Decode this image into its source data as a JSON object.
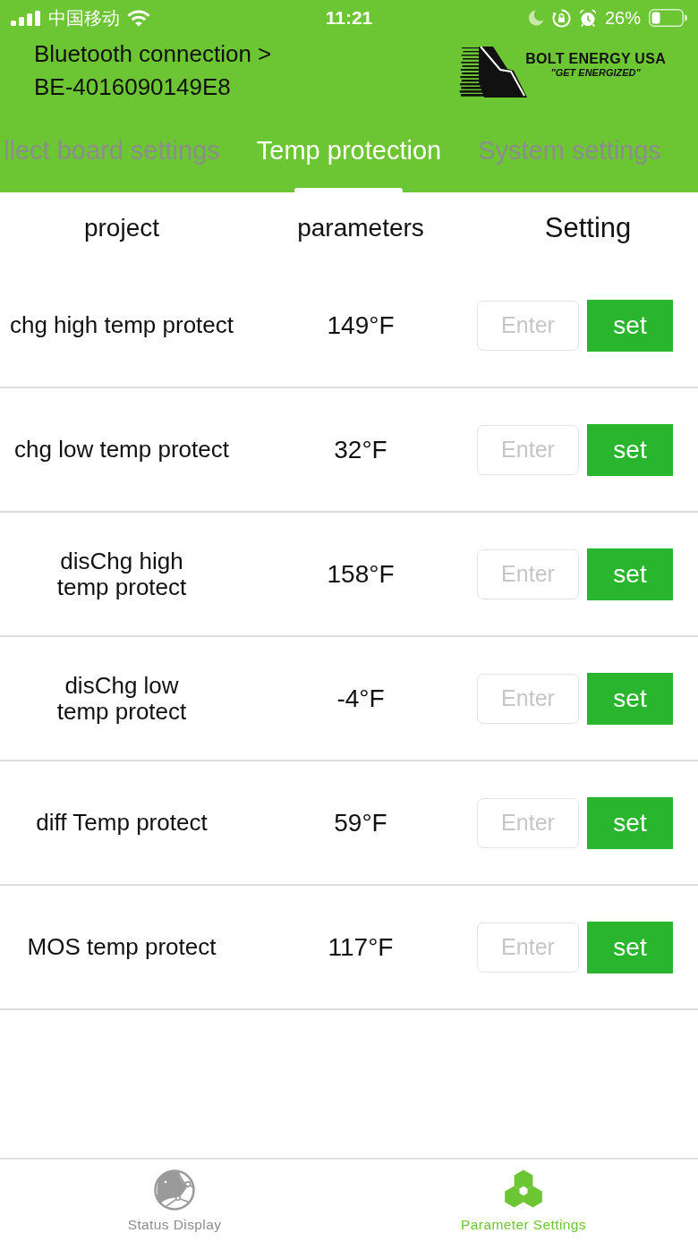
{
  "status_bar": {
    "carrier": "中国移动",
    "time": "11:21",
    "battery": "26%"
  },
  "header": {
    "connection_label": "Bluetooth connection >",
    "device_id": "BE-4016090149E8",
    "logo": {
      "title": "BOLT ENERGY USA",
      "tagline": "\"GET ENERGIZED\""
    }
  },
  "tabs": [
    {
      "label": "llect board settings",
      "selected": false
    },
    {
      "label": "Temp protection",
      "selected": true
    },
    {
      "label": "System settings",
      "selected": false
    }
  ],
  "table": {
    "columns": [
      "project",
      "parameters",
      "Setting"
    ],
    "rows": [
      {
        "project": "chg high temp protect",
        "parameter": "149°F",
        "placeholder": "Enter",
        "button": "set"
      },
      {
        "project": "chg low temp protect",
        "parameter": "32°F",
        "placeholder": "Enter",
        "button": "set"
      },
      {
        "project": "disChg high\ntemp protect",
        "parameter": "158°F",
        "placeholder": "Enter",
        "button": "set"
      },
      {
        "project": "disChg low\ntemp protect",
        "parameter": "-4°F",
        "placeholder": "Enter",
        "button": "set"
      },
      {
        "project": "diff Temp protect",
        "parameter": "59°F",
        "placeholder": "Enter",
        "button": "set"
      },
      {
        "project": "MOS temp protect",
        "parameter": "117°F",
        "placeholder": "Enter",
        "button": "set"
      }
    ]
  },
  "bottom_nav": [
    {
      "kind": "status",
      "label": "Status Display",
      "selected": false
    },
    {
      "kind": "parameters",
      "label": "Parameter Settings",
      "selected": true
    }
  ]
}
